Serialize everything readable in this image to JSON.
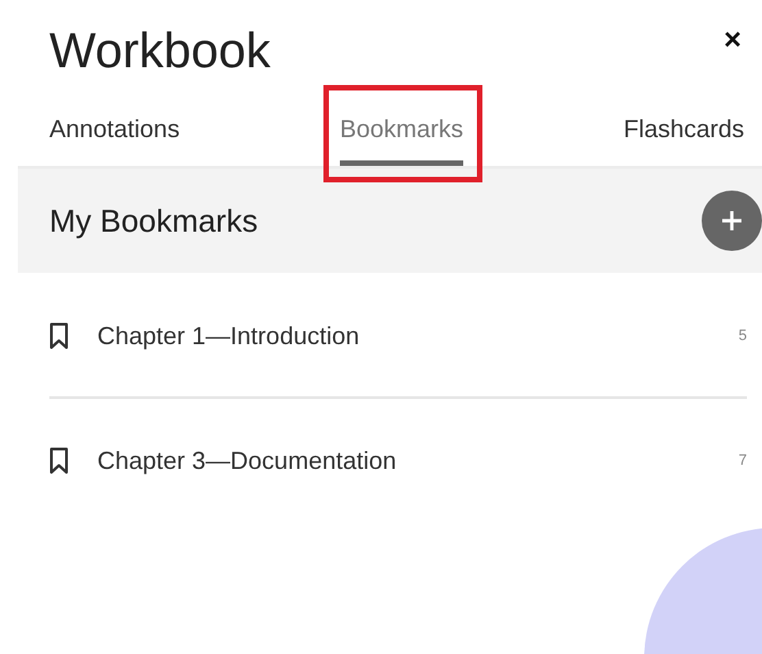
{
  "window": {
    "title": "Workbook",
    "close": "×"
  },
  "tabs": [
    {
      "label": "Annotations",
      "selected": false,
      "highlighted": false
    },
    {
      "label": "Bookmarks",
      "selected": true,
      "highlighted": true
    },
    {
      "label": "Flashcards",
      "selected": false,
      "highlighted": false
    }
  ],
  "section": {
    "title": "My Bookmarks"
  },
  "bookmarks": [
    {
      "title": "Chapter 1—Introduction",
      "page": "5"
    },
    {
      "title": "Chapter 3—Documentation",
      "page": "7"
    }
  ]
}
